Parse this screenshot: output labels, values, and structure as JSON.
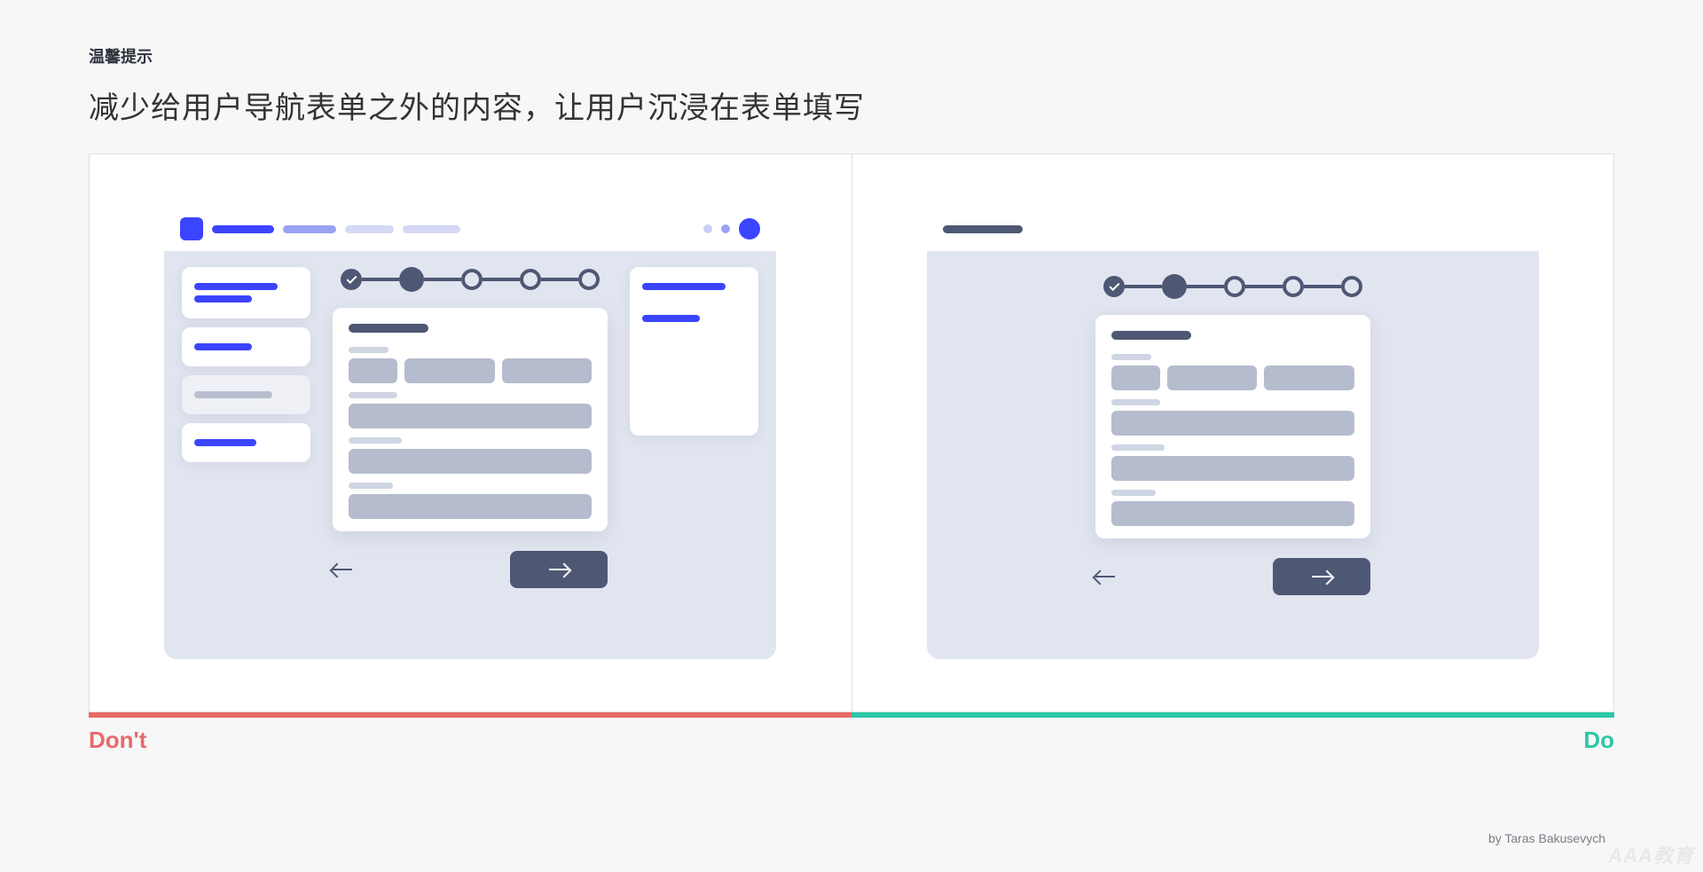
{
  "header": {
    "eyebrow": "温馨提示",
    "headline": "减少给用户导航表单之外的内容，让用户沉浸在表单填写"
  },
  "labels": {
    "dont": "Don't",
    "do": "Do"
  },
  "byline": "by Taras Bakusevych",
  "watermark": "AAA教育",
  "colors": {
    "dont": "#e86a6a",
    "do": "#2ec7a6",
    "brand_blue": "#3b44ff",
    "slate": "#4e5874"
  }
}
